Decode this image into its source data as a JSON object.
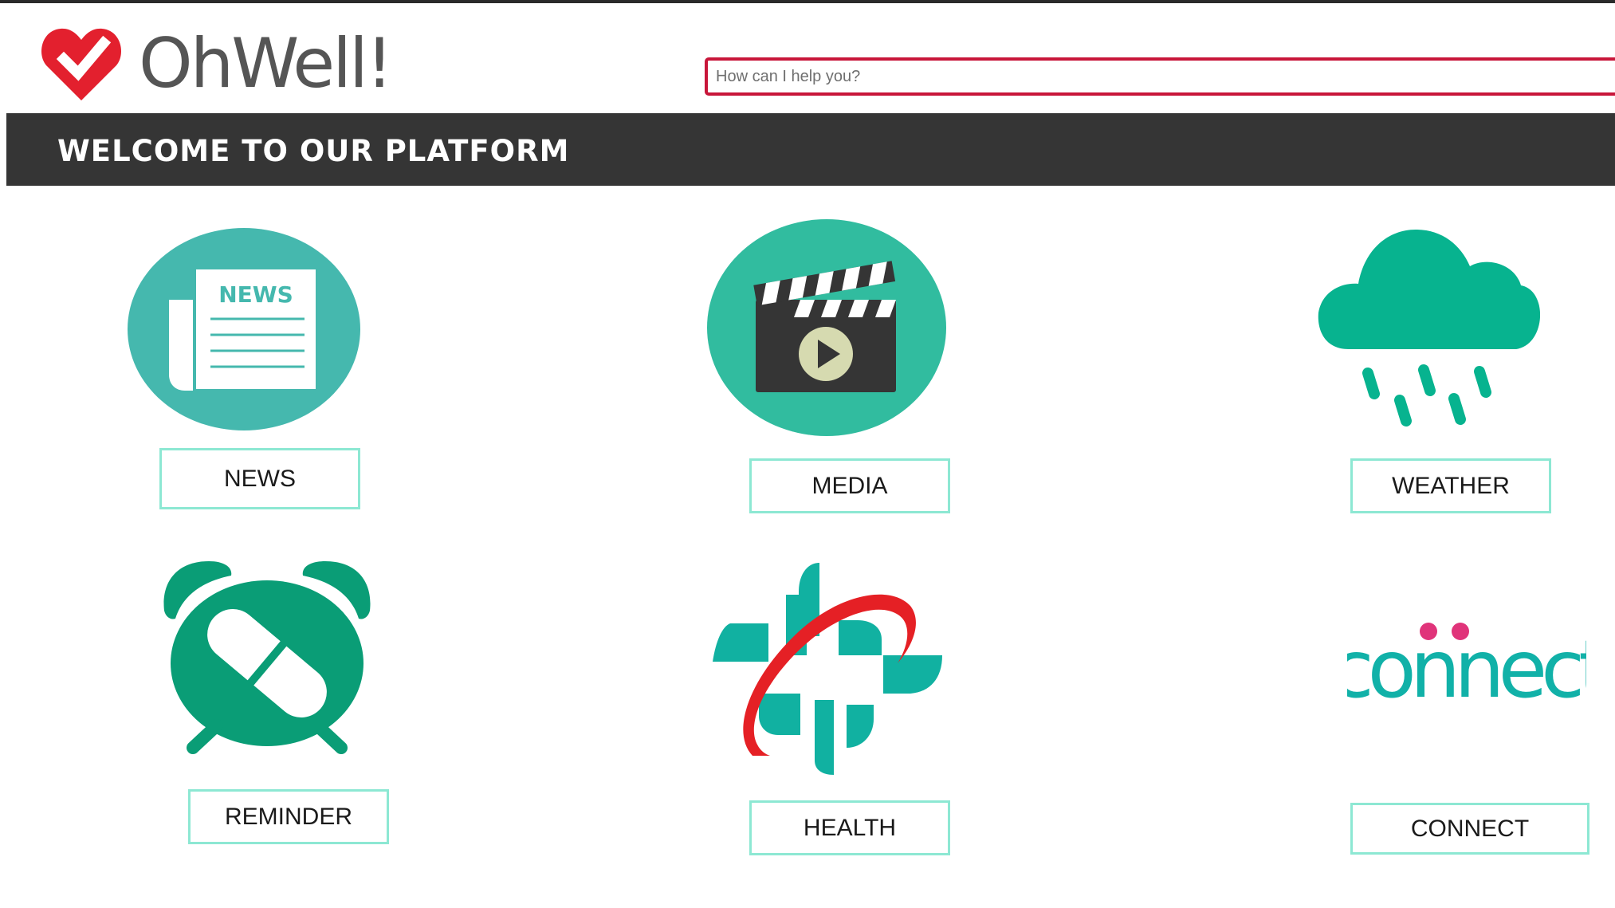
{
  "brand": {
    "name": "OhWell!"
  },
  "search": {
    "placeholder": "How can I help you?"
  },
  "banner": {
    "title": "WELCOME TO OUR PLATFORM"
  },
  "tiles": [
    {
      "label": "NEWS",
      "icon": "newspaper-icon",
      "icon_text": "NEWS"
    },
    {
      "label": "MEDIA",
      "icon": "clapperboard-play-icon"
    },
    {
      "label": "WEATHER",
      "icon": "rain-cloud-icon"
    },
    {
      "label": "REMINDER",
      "icon": "pill-alarm-clock-icon"
    },
    {
      "label": "HEALTH",
      "icon": "medical-cross-icon"
    },
    {
      "label": "CONNECT",
      "icon": "connect-logo-icon",
      "icon_text": "connect"
    }
  ],
  "colors": {
    "accent": "#c8163a",
    "teal": "#13b39a",
    "tile_border": "#8de8d3",
    "banner": "#353535"
  }
}
